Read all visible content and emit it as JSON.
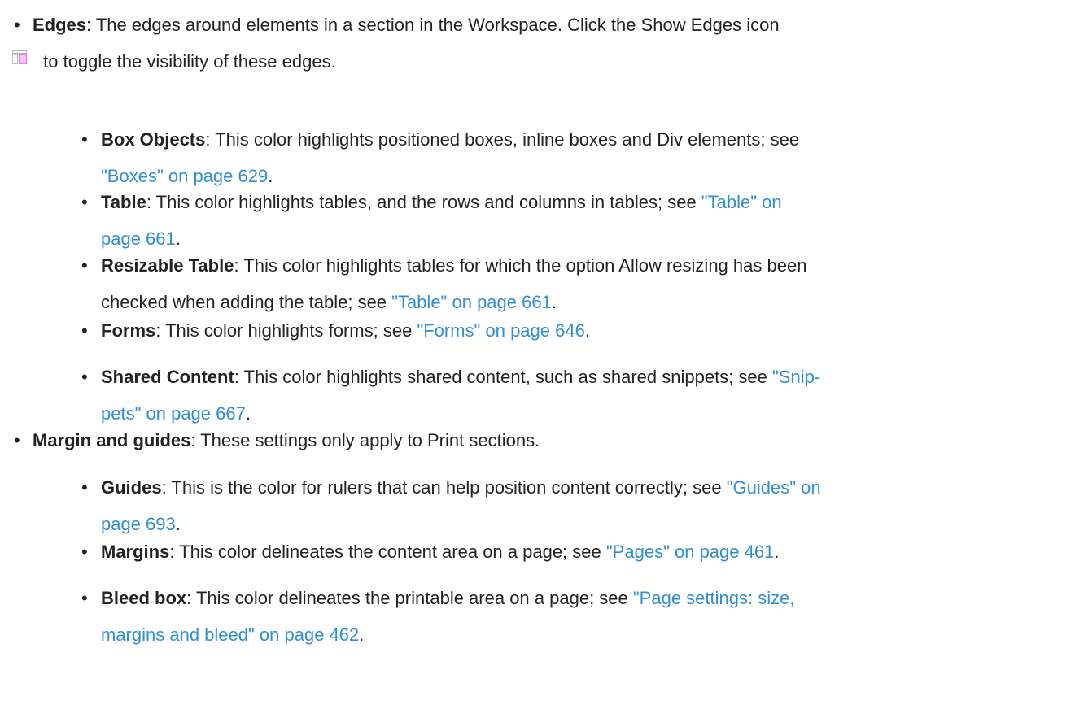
{
  "items": [
    {
      "term": "Edges",
      "before": ": The edges around elements in a section in the Workspace. Click the Show Edges icon",
      "icon": "show-edges-icon",
      "after": "to toggle the visibility of these edges."
    },
    {
      "term": "Box Objects",
      "before": ": This color highlights positioned boxes, inline boxes and Div elements; see ",
      "link": "\"Boxes\" on page 629",
      "after": "."
    },
    {
      "term": "Table",
      "before": ": This color highlights tables, and the rows and columns in tables; see ",
      "link_a": "\"Table\" on",
      "link_b": "page 661",
      "after": "."
    },
    {
      "term": "Resizable Table",
      "before_a": ": This color highlights tables for which the option Allow resizing has been",
      "before_b": "checked when adding the table; see ",
      "link": "\"Table\" on page 661",
      "after": "."
    },
    {
      "term": "Forms",
      "before": ": This color highlights forms; see ",
      "link": "\"Forms\" on page 646",
      "after": "."
    },
    {
      "term": "Shared Content",
      "before": ": This color highlights shared content, such as shared snippets; see ",
      "link_a": "\"Snip-",
      "link_b": "pets\" on page 667",
      "after": "."
    },
    {
      "term": "Margin and guides",
      "before": ": These settings only apply to Print sections."
    },
    {
      "term": "Guides",
      "before": ": This is the color for rulers that can help position content correctly; see ",
      "link_a": "\"Guides\" on",
      "link_b": "page 693",
      "after": "."
    },
    {
      "term": "Margins",
      "before": ": This color delineates the content area on a page; see ",
      "link": "\"Pages\" on page 461",
      "after": "."
    },
    {
      "term": "Bleed box",
      "before": ": This color delineates the printable area on a page; see ",
      "link_a": "\"Page settings: size,",
      "link_b": "margins and bleed\" on page 462",
      "after": "."
    }
  ],
  "bullet_char": "•",
  "colors": {
    "text": "#222222",
    "link": "#2f8fd0",
    "icon_pink": "#f070f0",
    "icon_gray": "#b9b9b9"
  }
}
